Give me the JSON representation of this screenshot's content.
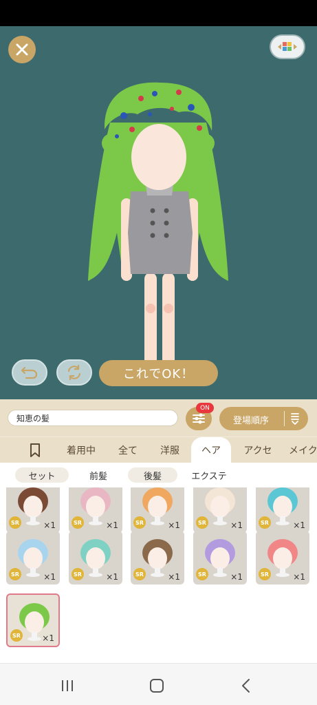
{
  "header": {
    "close_icon": "close-icon",
    "palette_icon": "palette-grid-icon"
  },
  "actions": {
    "undo_icon": "undo-icon",
    "rotate_icon": "rotate-icon",
    "ok_label": "これでOK！"
  },
  "toolbar": {
    "name_value": "知恵の髪",
    "filter_icon": "filter-sliders-icon",
    "filter_badge": "ON",
    "sort_label": "登場順序",
    "sort_icon": "sort-order-icon"
  },
  "tabs": [
    {
      "label": ""
    },
    {
      "label": "着用中"
    },
    {
      "label": "全て"
    },
    {
      "label": "洋服"
    },
    {
      "label": "ヘア"
    },
    {
      "label": "アクセ"
    },
    {
      "label": "メイク"
    }
  ],
  "bookmark_icon": "bookmark-icon",
  "active_tab": "ヘア",
  "subtabs": [
    {
      "label": "セット"
    },
    {
      "label": "前髪"
    },
    {
      "label": "後髪"
    },
    {
      "label": "エクステ"
    }
  ],
  "items": [
    {
      "rarity": "SR",
      "qty": "×1",
      "hair": "#7a4a35"
    },
    {
      "rarity": "SR",
      "qty": "×1",
      "hair": "#e9b7c4"
    },
    {
      "rarity": "SR",
      "qty": "×1",
      "hair": "#f0a860"
    },
    {
      "rarity": "SR",
      "qty": "×1",
      "hair": "#f3e6d6"
    },
    {
      "rarity": "SR",
      "qty": "×1",
      "hair": "#5cc7d4"
    },
    {
      "rarity": "SR",
      "qty": "×1",
      "hair": "#a9d4ee"
    },
    {
      "rarity": "SR",
      "qty": "×1",
      "hair": "#7fd1c4"
    },
    {
      "rarity": "SR",
      "qty": "×1",
      "hair": "#8a6a4a"
    },
    {
      "rarity": "SR",
      "qty": "×1",
      "hair": "#b39be0"
    },
    {
      "rarity": "SR",
      "qty": "×1",
      "hair": "#f08686"
    },
    {
      "rarity": "SR",
      "qty": "×1",
      "hair": "#7cc94a"
    }
  ],
  "nav": {
    "recents_icon": "recents-icon",
    "home_icon": "home-icon",
    "back_icon": "back-icon"
  },
  "colors": {
    "accent": "#c9a566",
    "stage_bg": "#3d6a6c",
    "badge": "#e8383d",
    "hair_green": "#7cc94a"
  }
}
